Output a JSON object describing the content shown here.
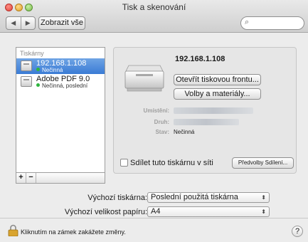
{
  "window": {
    "title": "Tisk a skenování"
  },
  "toolbar": {
    "back_glyph": "◀",
    "forward_glyph": "▶",
    "show_all_label": "Zobrazit vše",
    "search_placeholder": "",
    "search_icon": "magnifier-icon"
  },
  "printers": {
    "header": "Tiskárny",
    "items": [
      {
        "name": "192.168.1.108",
        "status": "Nečinná",
        "selected": true
      },
      {
        "name": "Adobe PDF 9.0",
        "status": "Nečinná, poslední",
        "selected": false
      }
    ],
    "add_label": "+",
    "remove_label": "−"
  },
  "detail": {
    "printer_name": "192.168.1.108",
    "open_queue_label": "Otevřít tiskovou frontu...",
    "options_label": "Volby a materiály...",
    "location_label": "Umístění:",
    "kind_label": "Druh:",
    "status_label": "Stav:",
    "status_value": "Nečinná",
    "share_label": "Sdílet tuto tiskárnu v síti",
    "share_checked": false,
    "share_prefs_label": "Předvolby Sdílení..."
  },
  "defaults": {
    "printer_label": "Výchozí tiskárna:",
    "printer_value": "Poslední použitá tiskárna",
    "paper_label": "Výchozí velikost papíru:",
    "paper_value": "A4"
  },
  "footer": {
    "lock_text": "Kliknutím na zámek zakážete změny.",
    "help_label": "?"
  },
  "colors": {
    "selection": "#3a7bd5",
    "status_dot": "#2fb53f"
  }
}
